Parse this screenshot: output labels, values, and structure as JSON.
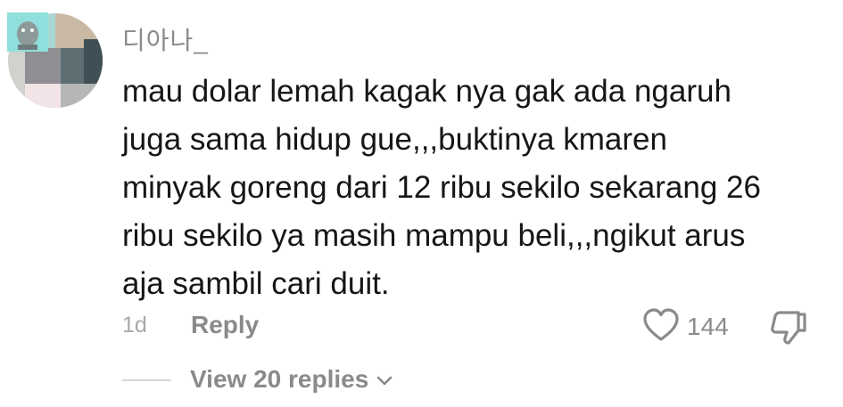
{
  "comment": {
    "username": "디아나_",
    "text": "mau dolar lemah kagak nya gak ada ngaruh\njuga sama hidup gue,,,buktinya kmaren\nminyak goreng dari 12 ribu sekilo sekarang 26\nribu sekilo ya masih mampu beli,,,ngikut arus\naja sambil cari duit.",
    "time": "1d",
    "reply_label": "Reply",
    "like_count": "144",
    "view_replies_label": "View 20 replies"
  },
  "icons": {
    "like": "heart-icon",
    "dislike": "thumbs-down-icon",
    "expand": "chevron-down-icon"
  },
  "colors": {
    "text": "#161616",
    "muted": "#8a8a8a"
  }
}
